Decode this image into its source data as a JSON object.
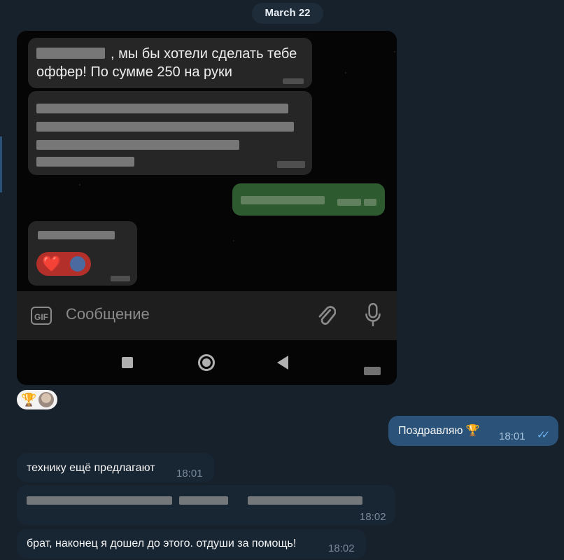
{
  "date_separator": "March 22",
  "screenshot": {
    "msg1_text_line1": ", мы бы хотели сделать тебе",
    "msg1_text_line2": "оффер! По сумме 250 на руки",
    "input_placeholder": "Сообщение",
    "gif_label": "GIF",
    "reaction_emoji": "❤️"
  },
  "reactions_under_photo": {
    "emoji": "🏆"
  },
  "messages": [
    {
      "direction": "out",
      "text": "Поздравляю 🏆",
      "time": "18:01",
      "read": true
    },
    {
      "direction": "in",
      "text": "технику ещё предлагают",
      "time": "18:01"
    },
    {
      "direction": "in",
      "text": "",
      "time": "18:02",
      "redacted": true
    },
    {
      "direction": "in",
      "text": "брат, наконец я дошел до этого. отдуши за помощь!",
      "time": "18:02"
    }
  ],
  "colors": {
    "background": "#17212b",
    "incoming_bubble": "#182533",
    "outgoing_bubble": "#2b5278",
    "check_color": "#6ab2f2"
  }
}
